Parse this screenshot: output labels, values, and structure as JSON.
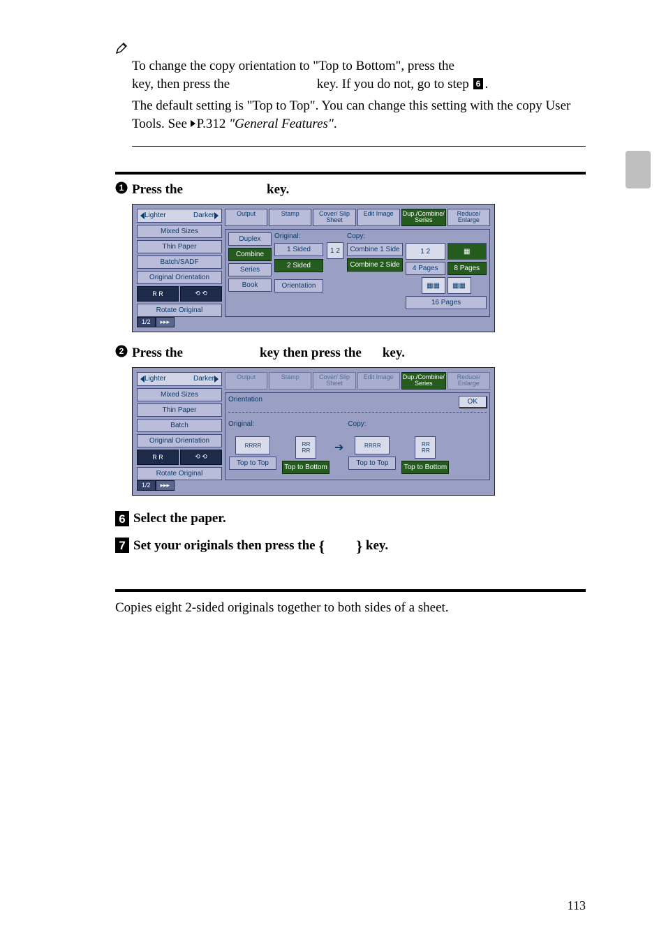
{
  "note": {
    "line1a": "To change the copy orientation to \"Top to Bottom\", press the ",
    "line1b": "key, then press the ",
    "line1c": " key. If you do not, go to step ",
    "line1d": ".",
    "line2a": "The default setting is \"Top to Top\". You can change this setting with the copy User Tools. See ",
    "line2b": "P.312 ",
    "line2c": "\"General Features\"",
    "line2d": "."
  },
  "substep1": {
    "prefix": "Press the ",
    "suffix": " key."
  },
  "substep2": {
    "prefix": "Press the ",
    "mid": " key then press the ",
    "suffix": " key."
  },
  "ui1": {
    "lighter": "Lighter",
    "darker": "Darker",
    "left": [
      "Mixed Sizes",
      "Thin Paper",
      "Batch/SADF",
      "Original Orientation",
      "Rotate Original"
    ],
    "tabs": [
      "Output",
      "Stamp",
      "Cover/\nSlip Sheet",
      "Edit\nImage",
      "Dup./Combine/\nSeries",
      "Reduce/\nEnlarge"
    ],
    "modes": [
      "Duplex",
      "Combine",
      "Series",
      "Book"
    ],
    "orientation_btn": "Orientation",
    "orig_label": "Original:",
    "copy_label": "Copy:",
    "orig_btns": [
      "1 Sided",
      "2 Sided"
    ],
    "copy_btns": [
      "Combine 1 Side",
      "Combine 2 Side"
    ],
    "page_btns": [
      "4 Pages",
      "8 Pages",
      "16 Pages"
    ],
    "pager": "1/2"
  },
  "ui2": {
    "lighter": "Lighter",
    "darker": "Darker",
    "left": [
      "Mixed Sizes",
      "Thin Paper",
      "Batch",
      "Original Orientation",
      "Rotate Original"
    ],
    "tabs": [
      "Output",
      "Stamp",
      "Cover/\nSlip Sheet",
      "Edit\nImage",
      "Dup./Combine/\nSeries",
      "Reduce/\nEnlarge"
    ],
    "section": "Orientation",
    "ok": "OK",
    "orig_label": "Original:",
    "copy_label": "Copy:",
    "orig_btns": [
      "Top to Top",
      "Top to Bottom"
    ],
    "copy_btns": [
      "Top to Top",
      "Top to Bottom"
    ],
    "pager": "1/2"
  },
  "step6": "Select the paper.",
  "step7a": "Set your originals then press the ",
  "step7b": " key.",
  "body_after": "Copies eight 2-sided originals together to both sides of a sheet.",
  "page_number": "113"
}
